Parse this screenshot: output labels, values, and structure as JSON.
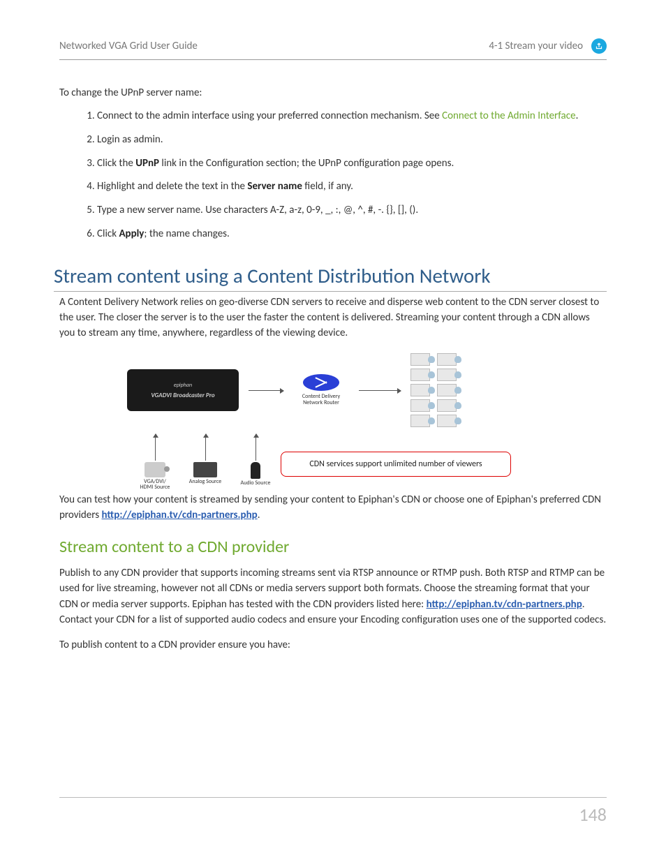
{
  "header": {
    "left": "Networked VGA Grid User Guide",
    "right": "4-1 Stream your video"
  },
  "intro": "To change the UPnP server name:",
  "steps": [
    {
      "pre": "Connect to the admin interface using your preferred connection mechanism. See ",
      "link": "Connect to the Admin Interface",
      "post": "."
    },
    {
      "text": "Login as admin."
    },
    {
      "pre": "Click the ",
      "bold": "UPnP",
      "post": " link in the Configuration section; the UPnP configuration page opens."
    },
    {
      "pre": "Highlight and delete the text in the ",
      "bold": "Server name",
      "post": " field, if any."
    },
    {
      "text": "Type a new server name. Use characters A-Z, a-z, 0-9, _, :, @, ^, #, -. {}, [], ()."
    },
    {
      "pre": "Click ",
      "bold": "Apply",
      "post": "; the name changes."
    }
  ],
  "section": {
    "title": "Stream content using a Content Distribution Network",
    "para1": "A Content Delivery Network relies on geo-diverse CDN servers to receive and disperse web content to the CDN server closest to the user. The closer the server is to the user the faster the content is delivered. Streaming your content through a CDN allows you to stream any time, anywhere, regardless of the viewing device.",
    "para2_pre": "You can test how your content is streamed by sending your content to Epiphan's CDN or choose one of Epiphan's preferred CDN providers ",
    "para2_link": "http://epiphan.tv/cdn-partners.php",
    "para2_post": "."
  },
  "diagram": {
    "device_brand": "epiphan",
    "device_model": "VGADVI Broadcaster Pro",
    "router_label": "Content Delivery Network Router",
    "callout": "CDN services support unlimited number of viewers",
    "sources": [
      {
        "label": "VGA/DVI/\nHDMI Source"
      },
      {
        "label": "Analog Source"
      },
      {
        "label": "Audio Source"
      }
    ]
  },
  "subsection": {
    "title": "Stream content to a CDN provider",
    "para_pre": "Publish to any CDN provider that supports incoming streams sent via RTSP announce or RTMP push. Both RTSP and RTMP can be used for live streaming, however not all CDNs or media servers support both formats. Choose the streaming format that your CDN or media server supports. Epiphan has tested with the CDN providers listed here: ",
    "para_link": "http://epiphan.tv/cdn-partners.php",
    "para_post": ". Contact your CDN for a list of supported audio codecs and ensure your Encoding configuration uses one of the supported codecs.",
    "para2": "To publish content to a CDN provider ensure you have:"
  },
  "page_number": "148"
}
